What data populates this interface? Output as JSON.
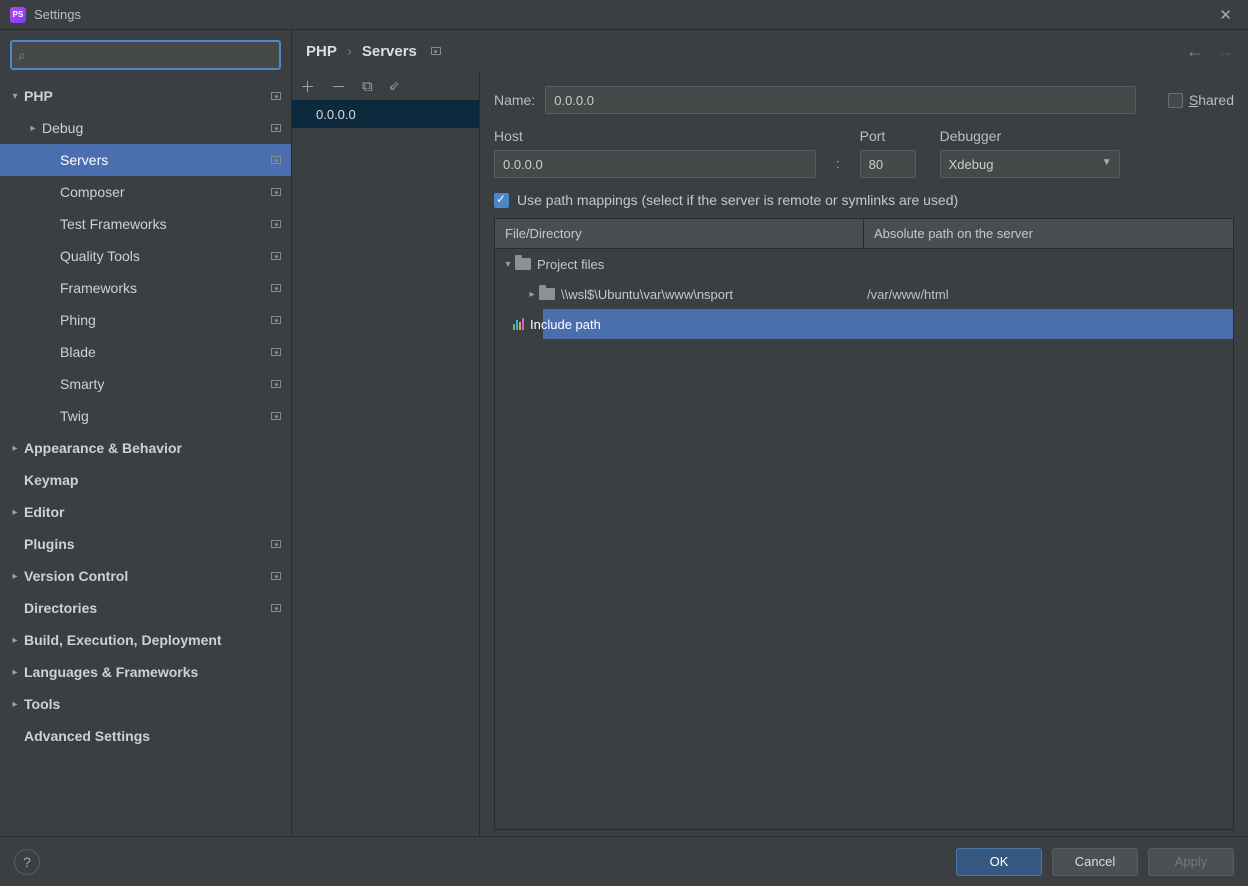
{
  "window": {
    "title": "Settings"
  },
  "sidebar": {
    "items": [
      {
        "label": "PHP",
        "indent": 0,
        "bold": true,
        "chev": "▾",
        "badge": true
      },
      {
        "label": "Debug",
        "indent": 1,
        "bold": false,
        "chev": "▸",
        "badge": true
      },
      {
        "label": "Servers",
        "indent": 2,
        "bold": false,
        "chev": "",
        "badge": true,
        "selected": true
      },
      {
        "label": "Composer",
        "indent": 2,
        "bold": false,
        "chev": "",
        "badge": true
      },
      {
        "label": "Test Frameworks",
        "indent": 2,
        "bold": false,
        "chev": "",
        "badge": true
      },
      {
        "label": "Quality Tools",
        "indent": 2,
        "bold": false,
        "chev": "",
        "badge": true
      },
      {
        "label": "Frameworks",
        "indent": 2,
        "bold": false,
        "chev": "",
        "badge": true
      },
      {
        "label": "Phing",
        "indent": 2,
        "bold": false,
        "chev": "",
        "badge": true
      },
      {
        "label": "Blade",
        "indent": 2,
        "bold": false,
        "chev": "",
        "badge": true
      },
      {
        "label": "Smarty",
        "indent": 2,
        "bold": false,
        "chev": "",
        "badge": true
      },
      {
        "label": "Twig",
        "indent": 2,
        "bold": false,
        "chev": "",
        "badge": true
      },
      {
        "label": "Appearance & Behavior",
        "indent": 0,
        "bold": true,
        "chev": "▸",
        "badge": false
      },
      {
        "label": "Keymap",
        "indent": 0,
        "bold": true,
        "chev": "",
        "badge": false
      },
      {
        "label": "Editor",
        "indent": 0,
        "bold": true,
        "chev": "▸",
        "badge": false
      },
      {
        "label": "Plugins",
        "indent": 0,
        "bold": true,
        "chev": "",
        "badge": true
      },
      {
        "label": "Version Control",
        "indent": 0,
        "bold": true,
        "chev": "▸",
        "badge": true
      },
      {
        "label": "Directories",
        "indent": 0,
        "bold": true,
        "chev": "",
        "badge": true
      },
      {
        "label": "Build, Execution, Deployment",
        "indent": 0,
        "bold": true,
        "chev": "▸",
        "badge": false
      },
      {
        "label": "Languages & Frameworks",
        "indent": 0,
        "bold": true,
        "chev": "▸",
        "badge": false
      },
      {
        "label": "Tools",
        "indent": 0,
        "bold": true,
        "chev": "▸",
        "badge": false
      },
      {
        "label": "Advanced Settings",
        "indent": 0,
        "bold": true,
        "chev": "",
        "badge": false
      }
    ]
  },
  "breadcrumb": {
    "a": "PHP",
    "b": "Servers"
  },
  "serverList": {
    "selected": "0.0.0.0"
  },
  "form": {
    "nameLabel": "Name:",
    "name": "0.0.0.0",
    "sharedLabel": "Shared",
    "hostLabel": "Host",
    "host": "0.0.0.0",
    "portLabel": "Port",
    "port": "80",
    "debuggerLabel": "Debugger",
    "debugger": "Xdebug",
    "pathCheck": "Use path mappings (select if the server is remote or symlinks are used)",
    "col1": "File/Directory",
    "col2": "Absolute path on the server",
    "projectFiles": "Project files",
    "localPath": "\\\\wsl$\\Ubuntu\\var\\www\\nsport",
    "serverPath": "/var/www/html",
    "includePath": "Include path"
  },
  "footer": {
    "ok": "OK",
    "cancel": "Cancel",
    "apply": "Apply"
  }
}
